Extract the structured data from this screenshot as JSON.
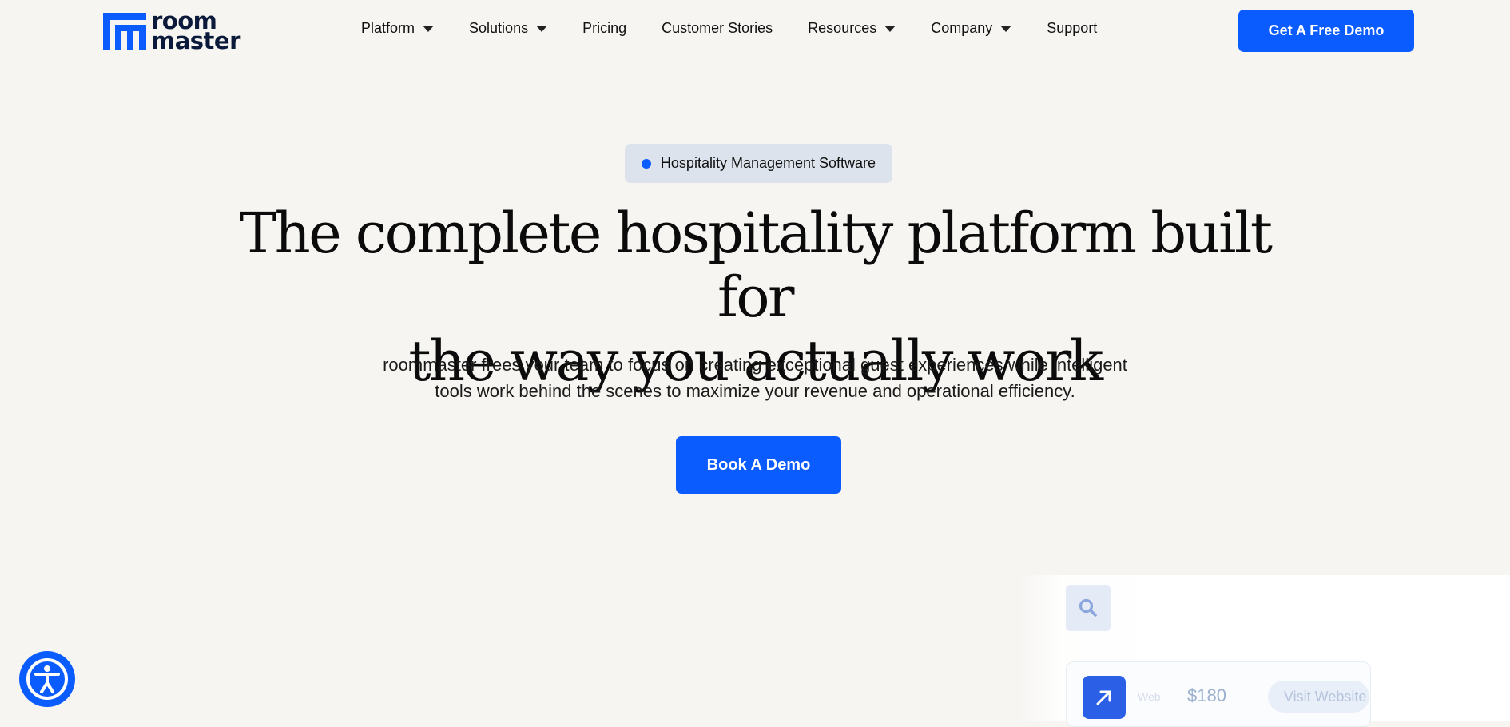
{
  "brand": {
    "line1": "room",
    "line2": "master",
    "color": "#0a5cff"
  },
  "nav": {
    "items": [
      {
        "label": "Platform",
        "has_caret": true
      },
      {
        "label": "Solutions",
        "has_caret": true
      },
      {
        "label": "Pricing",
        "has_caret": false
      },
      {
        "label": "Customer Stories",
        "has_caret": false
      },
      {
        "label": "Resources",
        "has_caret": true
      },
      {
        "label": "Company",
        "has_caret": true
      },
      {
        "label": "Support",
        "has_caret": false
      }
    ],
    "cta_label": "Get A Free Demo"
  },
  "hero": {
    "badge": "Hospitality Management Software",
    "title_line1": "The complete hospitality platform built for",
    "title_line2": "the way you actually work",
    "subtitle_line1": "roommaster frees your team to focus on creating exceptional guest experiences while intelligent",
    "subtitle_line2": "tools work behind the scenes to maximize your revenue and operational efficiency.",
    "cta_label": "Book A Demo"
  },
  "preview": {
    "search_icon": "search-icon",
    "arrow_icon": "arrow-up-right-icon",
    "faded_tag": "Web",
    "price": "$180",
    "visit_label": "Visit Website"
  },
  "accessibility": {
    "icon": "accessibility-icon"
  },
  "colors": {
    "accent": "#0a5cff",
    "background": "#f6f5f2",
    "badge_bg": "#dde3ec"
  }
}
